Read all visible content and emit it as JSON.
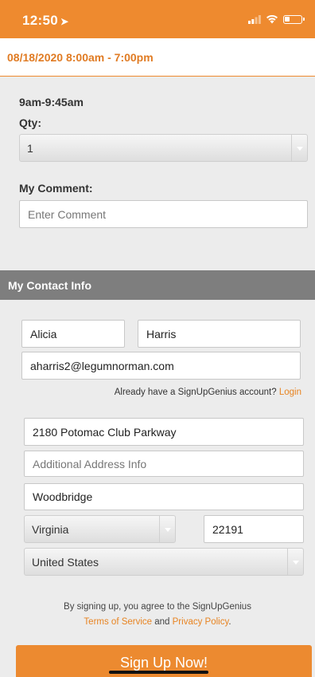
{
  "status_bar": {
    "time": "12:50",
    "location_arrow": "location-arrow-icon",
    "signal": "cellular-signal-icon",
    "wifi": "wifi-icon",
    "battery": "battery-icon"
  },
  "date_header": {
    "text": "08/18/2020 8:00am - 7:00pm"
  },
  "slot": {
    "time_label": "9am-9:45am",
    "qty_label": "Qty:",
    "qty_value": "1"
  },
  "comment": {
    "label": "My Comment:",
    "placeholder": "Enter Comment"
  },
  "contact": {
    "header": "My Contact Info",
    "first_name": "Alicia",
    "last_name": "Harris",
    "email": "aharris2@legumnorman.com",
    "account_prompt": "Already have a SignUpGenius account?",
    "login_link": "Login",
    "address1": "2180 Potomac Club Parkway",
    "address2_placeholder": "Additional Address Info",
    "city": "Woodbridge",
    "state": "Virginia",
    "zip": "22191",
    "country": "United States"
  },
  "terms": {
    "line1": "By signing up, you agree to the SignUpGenius",
    "tos_link": "Terms of Service",
    "and_text": " and ",
    "privacy_link": "Privacy Policy",
    "period": "."
  },
  "submit": {
    "label": "Sign Up Now!"
  },
  "colors": {
    "accent": "#ee8a2f",
    "header_gray": "#7e7e7e",
    "background": "#ececec"
  }
}
